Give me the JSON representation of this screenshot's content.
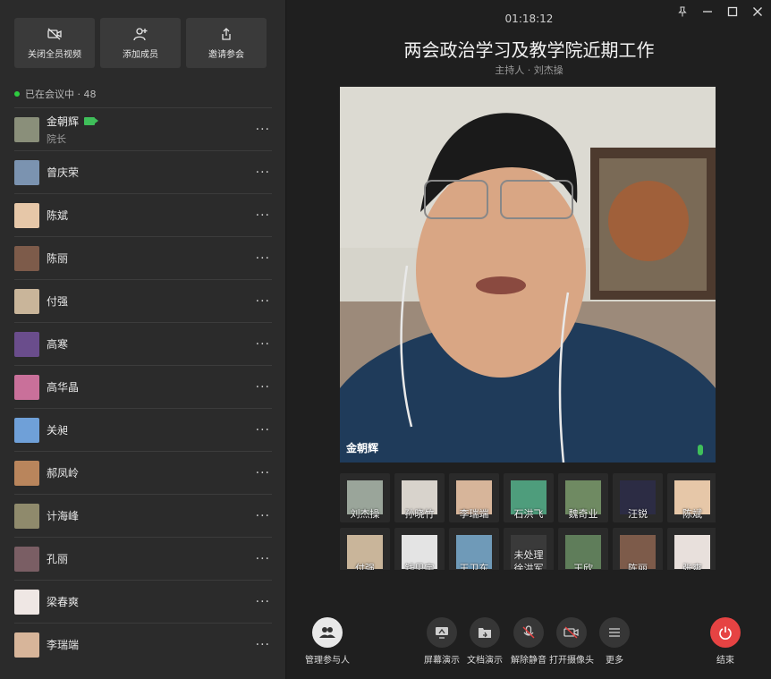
{
  "sidebar": {
    "actions": [
      {
        "label": "关闭全员视频",
        "icon": "video-off-icon"
      },
      {
        "label": "添加成员",
        "icon": "add-member-icon"
      },
      {
        "label": "邀请参会",
        "icon": "share-icon"
      }
    ],
    "status": "已在会议中 · 48",
    "members": [
      {
        "name": "金朝辉",
        "sub": "院长",
        "camera_on": true,
        "color": "#8a8f7a"
      },
      {
        "name": "曾庆荣",
        "color": "#7b93b0"
      },
      {
        "name": "陈斌",
        "color": "#e6c7a8"
      },
      {
        "name": "陈丽",
        "color": "#7d5b4a"
      },
      {
        "name": "付强",
        "color": "#c9b59a"
      },
      {
        "name": "高寒",
        "color": "#6a4d8c"
      },
      {
        "name": "高华晶",
        "color": "#c9709a"
      },
      {
        "name": "关昶",
        "color": "#6fa0d8"
      },
      {
        "name": "郝凤岭",
        "color": "#b9855c"
      },
      {
        "name": "计海峰",
        "color": "#8f8a6c"
      },
      {
        "name": "孔丽",
        "color": "#7a5e64"
      },
      {
        "name": "梁春爽",
        "color": "#efe7e4"
      },
      {
        "name": "李瑞端",
        "color": "#d7b59a"
      }
    ]
  },
  "main": {
    "timer": "01:18:12",
    "title": "两会政治学习及教学院近期工作",
    "host": "主持人 · 刘杰操",
    "active_speaker": "金朝辉",
    "thumbnails": [
      {
        "name": "刘杰操",
        "color": "#9aa59a"
      },
      {
        "name": "孙晓竹",
        "color": "#d8d3cc"
      },
      {
        "name": "李瑞端",
        "color": "#d7b59a"
      },
      {
        "name": "石洪飞",
        "color": "#4e9d7c"
      },
      {
        "name": "魏奇业",
        "color": "#6f8a62"
      },
      {
        "name": "汪锐",
        "color": "#2c2c44"
      },
      {
        "name": "陈斌",
        "color": "#e6c7a8"
      },
      {
        "name": "付强",
        "color": "#c9b59a"
      },
      {
        "name": "钱思宇",
        "color": "#e4e4e4"
      },
      {
        "name": "王卫东",
        "color": "#6f9ab8"
      },
      {
        "name": "徐洪军",
        "status": "未处理",
        "color": "#3a3a3a"
      },
      {
        "name": "王欣",
        "color": "#5f7d5a"
      },
      {
        "name": "陈丽",
        "color": "#7d5b4a"
      },
      {
        "name": "张爽",
        "color": "#e8e0dc"
      }
    ],
    "toolbar": {
      "manage": "管理参与人",
      "screen_share": "屏幕演示",
      "doc_share": "文档演示",
      "unmute": "解除静音",
      "camera": "打开摄像头",
      "more": "更多",
      "end": "结束"
    }
  },
  "colors": {
    "accent_green": "#3fbf5a",
    "end_red": "#e64343"
  }
}
